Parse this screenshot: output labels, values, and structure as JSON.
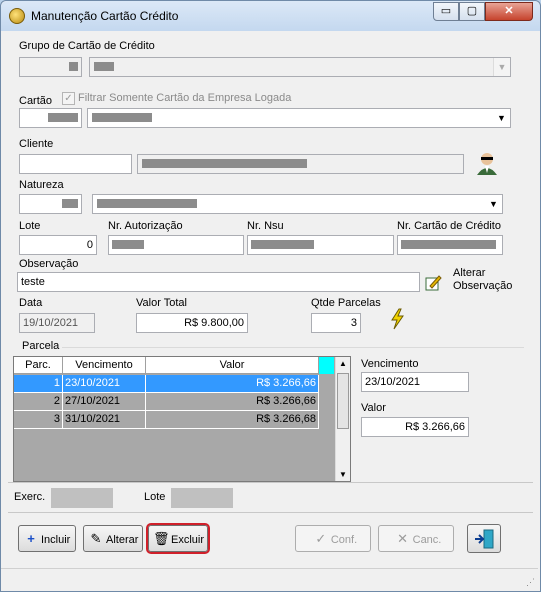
{
  "window": {
    "title": "Manutenção Cartão Crédito",
    "controls": {
      "minimize": "▭",
      "maximize": "▢",
      "close": "✕"
    }
  },
  "grupo": {
    "label": "Grupo de Cartão de Crédito"
  },
  "cartao": {
    "label": "Cartão",
    "filter_label": "Filtrar Somente Cartão da Empresa Logada",
    "filter_checked": true
  },
  "cliente": {
    "label": "Cliente"
  },
  "natureza": {
    "label": "Natureza"
  },
  "lote": {
    "label": "Lote",
    "value": "0"
  },
  "nr_autorizacao": {
    "label": "Nr. Autorização"
  },
  "nr_nsu": {
    "label": "Nr. Nsu"
  },
  "nr_cartao": {
    "label": "Nr. Cartão de Crédito"
  },
  "observacao": {
    "label": "Observação",
    "value": "teste",
    "alterar_label_1": "Alterar",
    "alterar_label_2": "Observação"
  },
  "data": {
    "label": "Data",
    "value": "19/10/2021"
  },
  "valor_total": {
    "label": "Valor Total",
    "value": "R$ 9.800,00"
  },
  "qtde_parcelas": {
    "label": "Qtde Parcelas",
    "value": "3"
  },
  "parcela": {
    "label": "Parcela",
    "columns": [
      "Parc.",
      "Vencimento",
      "Valor"
    ],
    "rows": [
      {
        "parc": "1",
        "vencimento": "23/10/2021",
        "valor": "R$ 3.266,66",
        "selected": true
      },
      {
        "parc": "2",
        "vencimento": "27/10/2021",
        "valor": "R$ 3.266,66",
        "selected": false
      },
      {
        "parc": "3",
        "vencimento": "31/10/2021",
        "valor": "R$ 3.266,68",
        "selected": false
      }
    ],
    "vencimento_label": "Vencimento",
    "vencimento_value": "23/10/2021",
    "valor_label": "Valor",
    "valor_value": "R$ 3.266,66"
  },
  "footer": {
    "exerc_label": "Exerc.",
    "lote_label": "Lote"
  },
  "buttons": {
    "incluir": "Incluir",
    "alterar": "Alterar",
    "excluir": "Excluir",
    "conf": "Conf.",
    "canc": "Canc."
  },
  "colors": {
    "selection": "#3399ff",
    "highlight": "#00ffff",
    "focus_outline": "#d0202a"
  }
}
